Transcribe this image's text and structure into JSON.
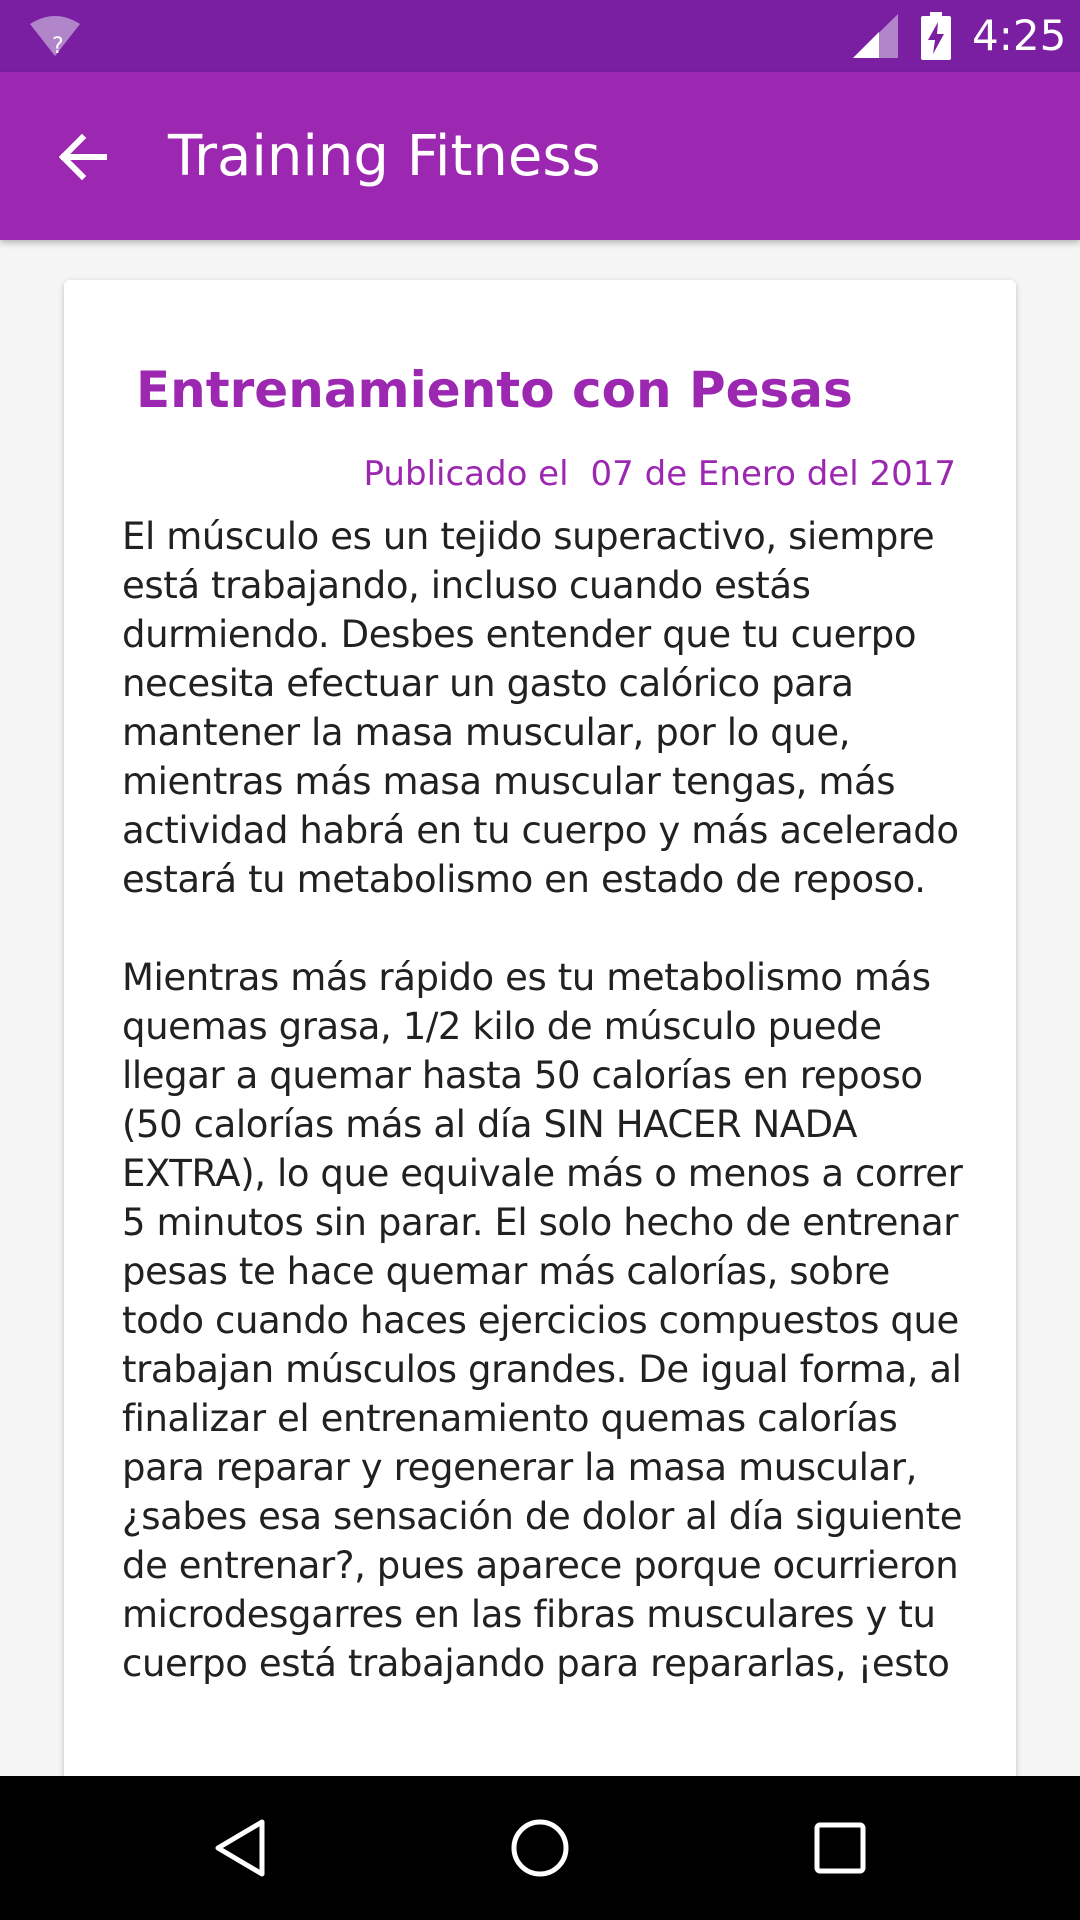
{
  "status_bar": {
    "time": "4:25",
    "icons": [
      "wifi-unknown-icon",
      "cell-signal-icon",
      "battery-charging-icon"
    ]
  },
  "app_bar": {
    "back_icon": "arrow-back-icon",
    "title": "Training Fitness",
    "color": "#9c27b0"
  },
  "article": {
    "title": "Entrenamiento con Pesas",
    "published_label": "Publicado el",
    "published_date": "07 de Enero del 2017",
    "paragraphs": [
      "El músculo es un tejido superactivo, siempre está trabajando, incluso cuando estás durmiendo. Desbes entender que tu cuerpo necesita efectuar un gasto calórico para mantener la masa muscular, por lo que, mientras más masa muscular tengas, más actividad habrá en tu cuerpo y más acelerado estará tu metabolismo en estado de reposo.",
      "Mientras más rápido es tu metabolismo más quemas grasa, 1/2 kilo de músculo puede llegar a quemar hasta 50 calorías en reposo (50 calorías más al día SIN HACER NADA EXTRA), lo que equivale más o menos a correr 5 minutos sin parar. El solo hecho de entrenar pesas te hace quemar más calorías, sobre todo cuando haces ejercicios compuestos que trabajan músculos grandes. De igual forma, al finalizar el entrenamiento quemas calorías para reparar y regenerar la masa muscular, ¿sabes esa sensación de dolor al día siguiente de entrenar?, pues aparece porque ocurrieron microdesgarres en las fibras musculares y tu cuerpo está trabajando para repararlas, ¡esto"
    ]
  },
  "nav_bar": {
    "buttons": [
      "back-triangle-icon",
      "home-circle-icon",
      "recents-square-icon"
    ]
  }
}
